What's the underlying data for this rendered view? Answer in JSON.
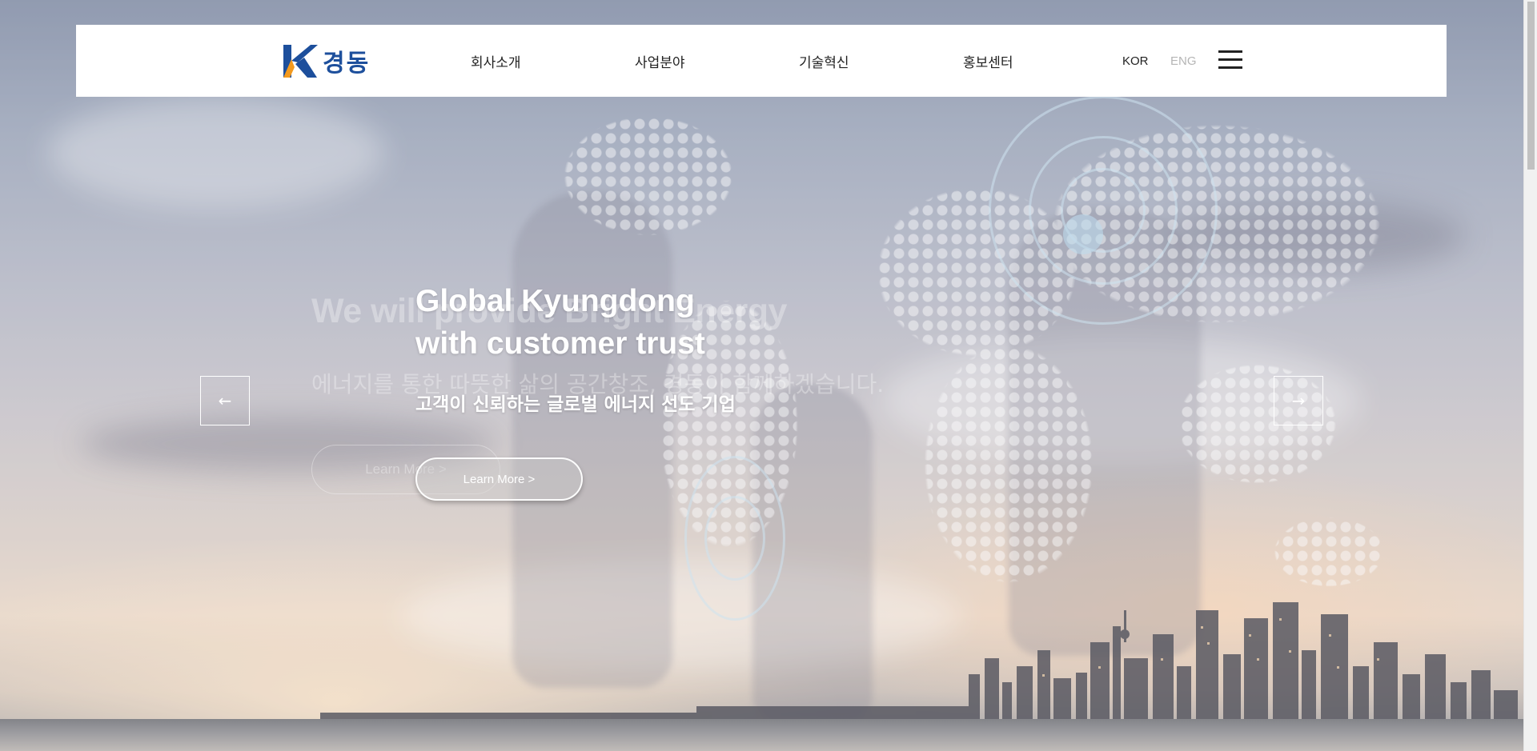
{
  "header": {
    "logo_text": "경동",
    "nav": [
      "회사소개",
      "사업분야",
      "기술혁신",
      "홍보센터"
    ],
    "lang_kor": "KOR",
    "lang_eng": "ENG"
  },
  "hero": {
    "ghost_title": "We will provide Bright Energy",
    "ghost_subtitle": "에너지를 통한 따뜻한 삶의 공간창조, 경동이 함께하겠습니다.",
    "ghost_button": "Learn More >",
    "title_line1": "Global Kyungdong",
    "title_line2": "with customer trust",
    "subtitle": "고객이 신뢰하는 글로벌 에너지 선도 기업",
    "button": "Learn More >",
    "prev_arrow": "←",
    "next_arrow": "→"
  },
  "colors": {
    "brand_blue": "#1d4f9c",
    "brand_orange": "#f39a1e",
    "header_bg": "#ffffff",
    "lang_inactive": "#b5b5b5"
  },
  "icons": {
    "menu": "hamburger-icon",
    "prev": "arrow-left-icon",
    "next": "arrow-right-icon"
  }
}
